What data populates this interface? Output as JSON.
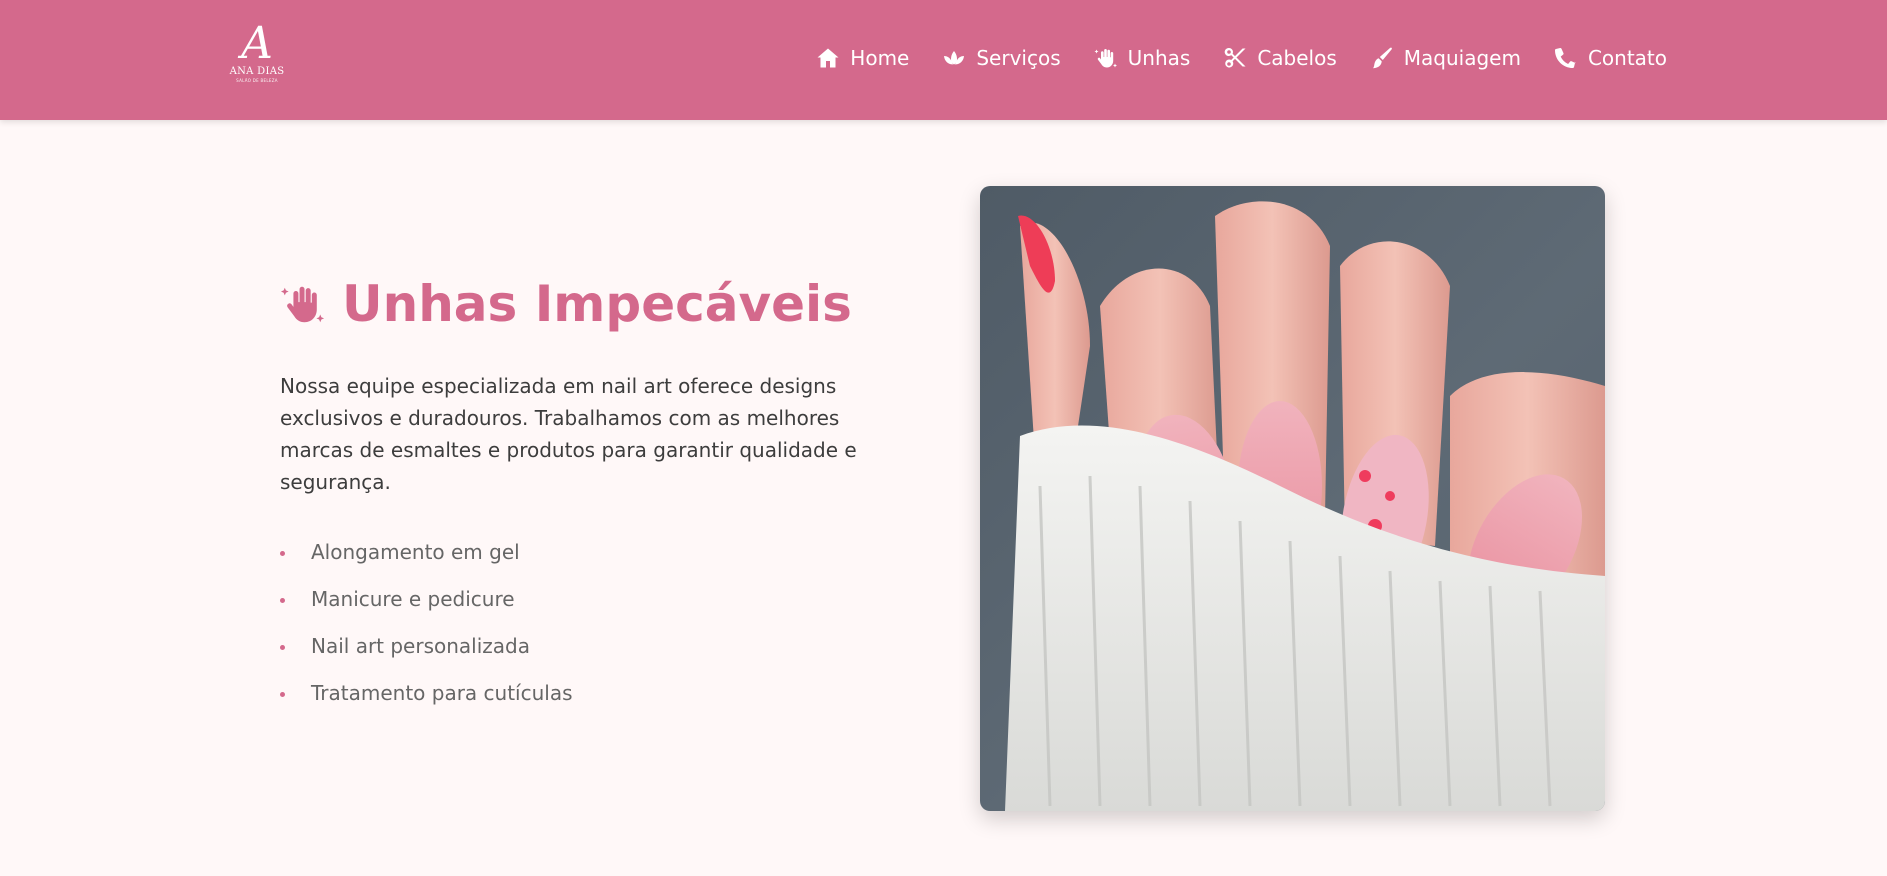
{
  "brand": {
    "monogram": "A",
    "name": "ANA DIAS",
    "tagline": "SALÃO DE BELEZA"
  },
  "nav": {
    "items": [
      {
        "label": "Home",
        "icon": "home-icon"
      },
      {
        "label": "Serviços",
        "icon": "lotus-icon"
      },
      {
        "label": "Unhas",
        "icon": "hand-sparkles-icon"
      },
      {
        "label": "Cabelos",
        "icon": "scissors-icon"
      },
      {
        "label": "Maquiagem",
        "icon": "brush-icon"
      },
      {
        "label": "Contato",
        "icon": "phone-icon"
      }
    ]
  },
  "section": {
    "title": "Unhas Impecáveis",
    "title_icon": "hand-sparkles-icon",
    "description": "Nossa equipe especializada em nail art oferece designs exclusivos e duradouros. Trabalhamos com as melhores marcas de esmaltes e produtos para garantir qualidade e segurança.",
    "features": [
      "Alongamento em gel",
      "Manicure e pedicure",
      "Nail art personalizada",
      "Tratamento para cutículas"
    ],
    "image": "manicure-photo"
  },
  "colors": {
    "brand": "#d4698c",
    "background": "#fff8f8",
    "text": "#3d3d3d",
    "muted_text": "#666666"
  }
}
